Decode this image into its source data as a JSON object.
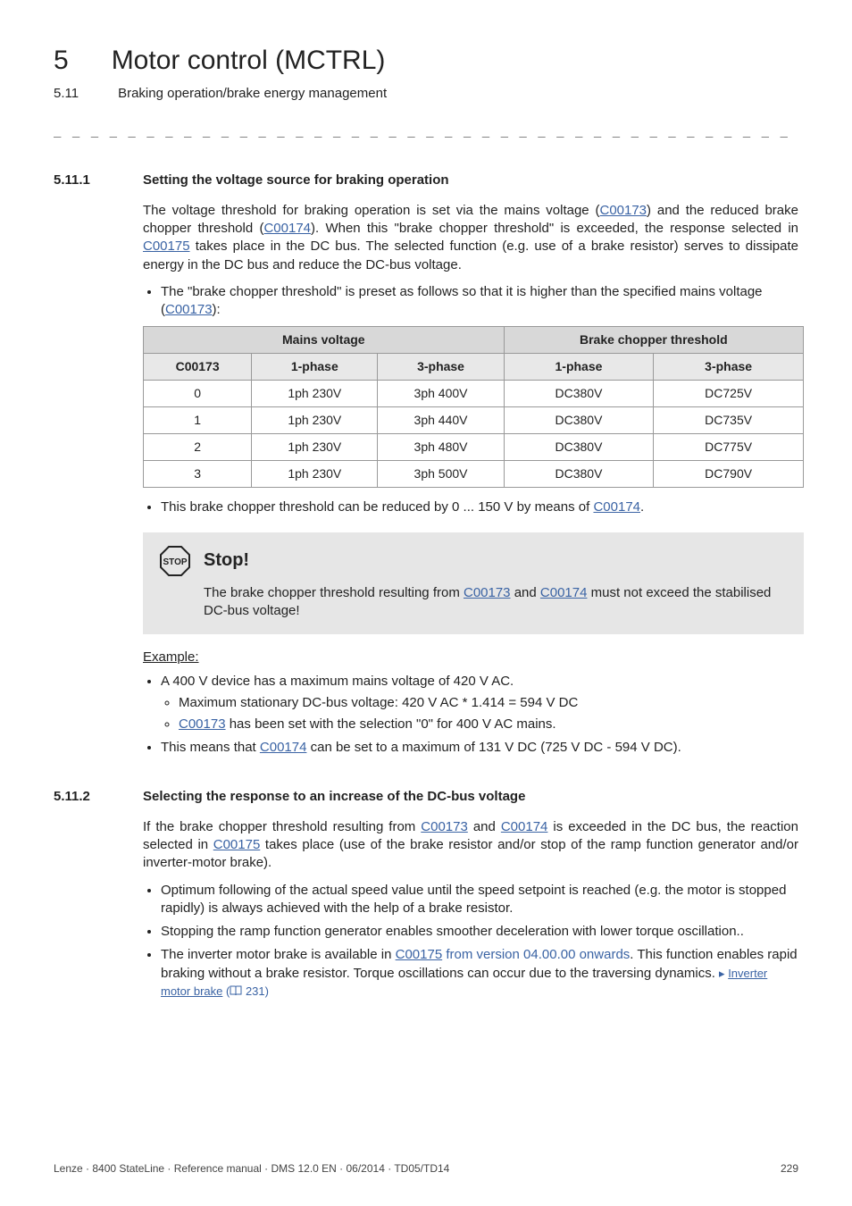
{
  "chapter": {
    "num": "5",
    "title": "Motor control (MCTRL)"
  },
  "subheader": {
    "num": "5.11",
    "title": "Braking operation/brake energy management"
  },
  "dash_rule": "_ _ _ _ _ _ _ _ _ _ _ _ _ _ _ _ _ _ _ _ _ _ _ _ _ _ _ _ _ _ _ _ _ _ _ _ _ _ _ _ _ _ _ _ _ _ _ _ _ _ _ _ _ _ _ _ _ _ _ _ _ _ _ _",
  "sec1": {
    "num": "5.11.1",
    "title": "Setting the voltage source for braking operation",
    "p1a": "The voltage threshold for braking operation is set via the mains voltage (",
    "p1b": ") and the reduced brake chopper threshold (",
    "p1c": "). When this \"brake chopper threshold\" is exceeded, the response selected in ",
    "p1d": " takes place in the DC bus. The selected function (e.g. use of a brake resistor) serves to dissipate energy in the DC bus and reduce the DC-bus voltage.",
    "b1a": "The \"brake chopper threshold\" is preset as follows so that it is higher than the specified mains voltage (",
    "b1b": "):",
    "b2a": "This brake chopper threshold can be reduced by 0 ... 150 V by means of ",
    "b2b": "."
  },
  "links": {
    "C00173": "C00173",
    "C00174": "C00174",
    "C00175": "C00175",
    "invbrake": "Inverter motor brake",
    "ver": "from version 04.00.00 onwards"
  },
  "table": {
    "head_main_voltage": "Mains voltage",
    "head_bct": "Brake chopper threshold",
    "col_c00173": "C00173",
    "col_1phase": "1-phase",
    "col_3phase": "3-phase",
    "rows": [
      {
        "c": "0",
        "mv1": "1ph 230V",
        "mv3": "3ph 400V",
        "b1": "DC380V",
        "b3": "DC725V"
      },
      {
        "c": "1",
        "mv1": "1ph 230V",
        "mv3": "3ph 440V",
        "b1": "DC380V",
        "b3": "DC735V"
      },
      {
        "c": "2",
        "mv1": "1ph 230V",
        "mv3": "3ph 480V",
        "b1": "DC380V",
        "b3": "DC775V"
      },
      {
        "c": "3",
        "mv1": "1ph 230V",
        "mv3": "3ph 500V",
        "b1": "DC380V",
        "b3": "DC790V"
      }
    ]
  },
  "stop": {
    "title": "Stop!",
    "t1": "The brake chopper threshold resulting from ",
    "t2": " and ",
    "t3": " must not exceed the stabilised DC-bus voltage!"
  },
  "example": {
    "label": "Example:",
    "b1": "A 400 V device has a maximum mains voltage of 420 V AC.",
    "s1": "Maximum stationary DC-bus voltage: 420 V AC * 1.414 = 594 V DC",
    "s2a": "",
    "s2b": " has been set with the selection \"0\" for 400 V AC mains.",
    "b2a": "This means that ",
    "b2b": " can be set to a maximum of 131 V DC (725 V DC - 594 V DC)."
  },
  "sec2": {
    "num": "5.11.2",
    "title": "Selecting the response to an increase of the DC-bus voltage",
    "p1a": "If the brake chopper threshold resulting from ",
    "p1b": " and ",
    "p1c": " is exceeded in the DC bus, the reaction selected in ",
    "p1d": " takes place (use of the brake resistor and/or stop of the ramp function generator and/or inverter-motor brake).",
    "b1": "Optimum following of the actual speed value until the speed setpoint is reached (e.g. the motor is stopped rapidly) is always achieved with the help of a brake resistor.",
    "b2": "Stopping the ramp function generator enables smoother deceleration with lower torque oscillation..",
    "b3a": "The inverter motor brake is available in ",
    "b3b": ". This function enables rapid braking without a brake resistor. Torque oscillations can occur due to the traversing dynamics. ",
    "b3_pg": " 231)"
  },
  "footer": {
    "left": "Lenze · 8400 StateLine · Reference manual · DMS 12.0 EN · 06/2014 · TD05/TD14",
    "right": "229"
  }
}
